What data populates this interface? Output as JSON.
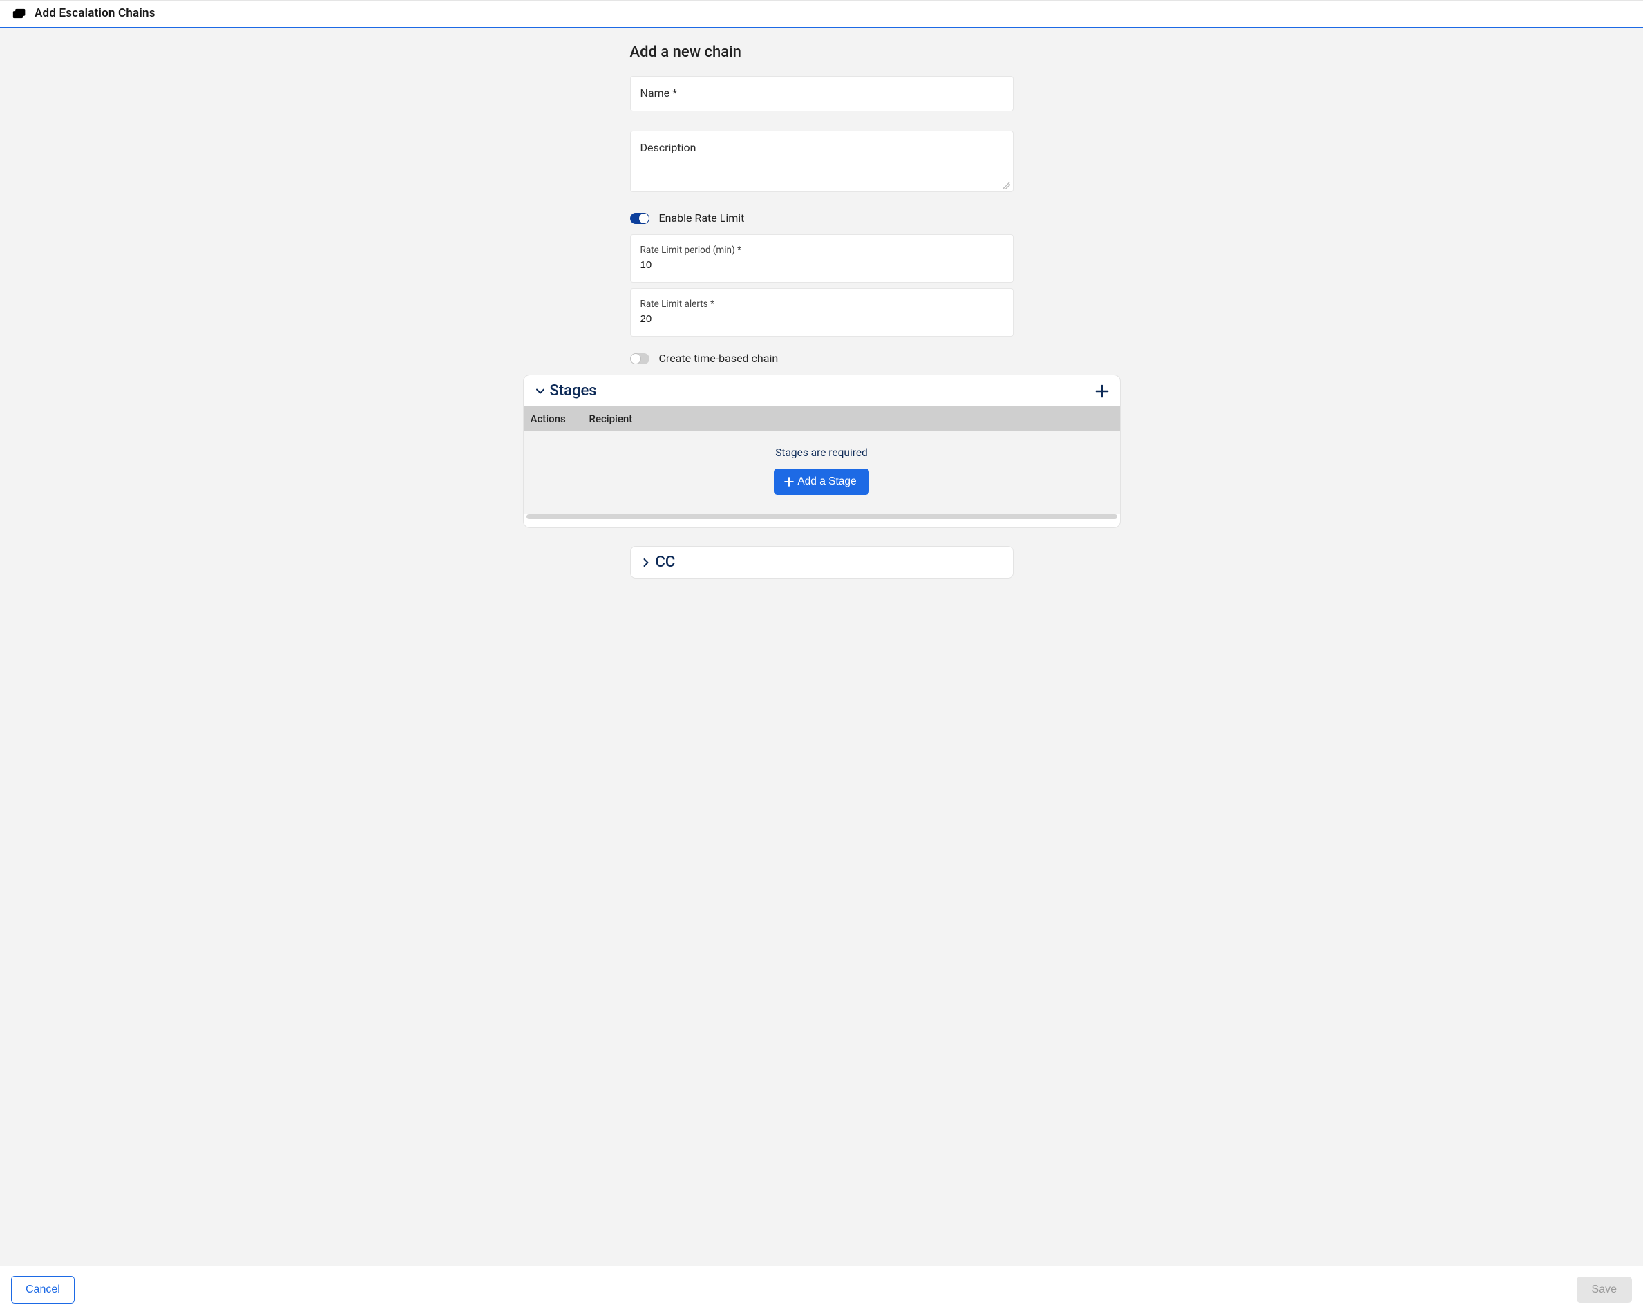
{
  "header": {
    "title": "Add Escalation Chains"
  },
  "form": {
    "section_title": "Add a new chain",
    "name_label": "Name *",
    "name_value": "",
    "description_label": "Description",
    "description_value": "",
    "rate_limit_toggle_label": "Enable Rate Limit",
    "rate_limit_enabled": true,
    "rate_limit_period_label": "Rate Limit period (min) *",
    "rate_limit_period_value": "10",
    "rate_limit_alerts_label": "Rate Limit alerts *",
    "rate_limit_alerts_value": "20",
    "time_based_toggle_label": "Create time-based chain",
    "time_based_enabled": false
  },
  "stages": {
    "title": "Stages",
    "columns": {
      "actions": "Actions",
      "recipient": "Recipient"
    },
    "empty_message": "Stages are required",
    "add_button_label": "Add a Stage"
  },
  "cc": {
    "title": "CC"
  },
  "footer": {
    "cancel_label": "Cancel",
    "save_label": "Save"
  }
}
